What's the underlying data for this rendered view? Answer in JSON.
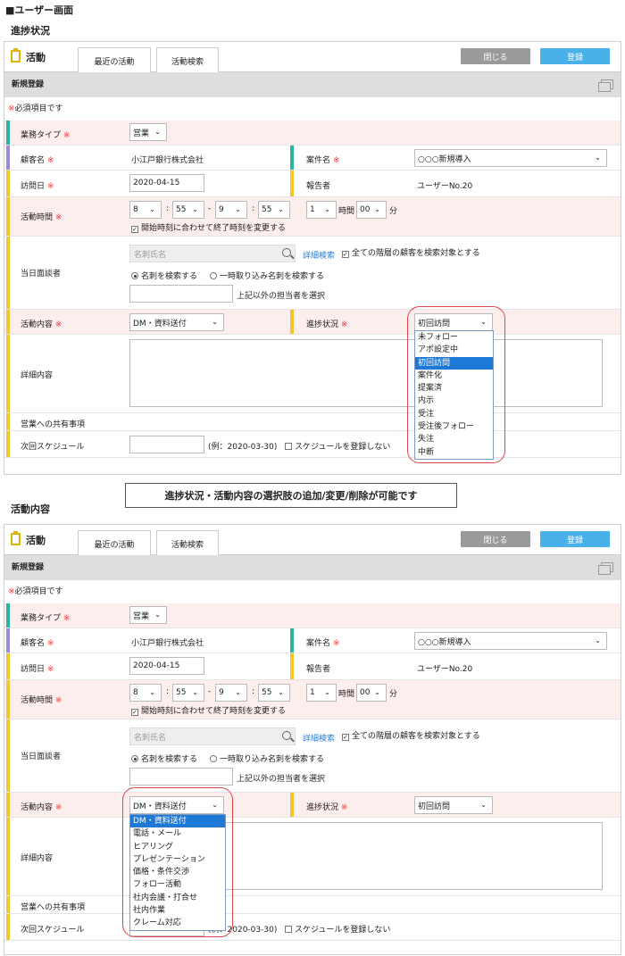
{
  "page_title": "■ユーザー画面",
  "section1_title": "進捗状況",
  "section2_title": "活動内容",
  "callout": "進捗状況・活動内容の選択肢の追加/変更/削除が可能です",
  "app": {
    "title": "活動",
    "tabs": [
      "最近の活動",
      "活動検索"
    ],
    "close_label": "閉じる",
    "register_label": "登録"
  },
  "header": "新規登録",
  "required_note": "必須項目です",
  "required_mark": "※",
  "form": {
    "business_type": {
      "label": "業務タイプ",
      "value": "営業"
    },
    "customer": {
      "label": "顧客名",
      "value": "小江戸銀行株式会社"
    },
    "case": {
      "label": "案件名",
      "value": "○○○新規導入"
    },
    "visit_date": {
      "label": "訪問日",
      "value": "2020-04-15"
    },
    "reporter": {
      "label": "報告者",
      "value": "ユーザーNo.20"
    },
    "activity_time": {
      "label": "活動時間",
      "start_hour": "8",
      "start_min": "55",
      "dash": "-",
      "end_hour": "9",
      "end_min": "55",
      "duration_hour": "1",
      "hour_unit": "時間",
      "duration_min": "00",
      "min_unit": "分",
      "auto_end_note": "開始時刻に合わせて終了時刻を変更する"
    },
    "attendees": {
      "label": "当日面談者",
      "search_placeholder": "名刺氏名",
      "detail_search": "詳細検索",
      "all_levels": "全ての階層の顧客を検索対象とする",
      "radio_card": "名刺を検索する",
      "radio_temp": "一時取り込み名刺を検索する",
      "other_staff": "上記以外の担当者を選択"
    },
    "activity_content": {
      "label": "活動内容",
      "value": "DM・資料送付"
    },
    "progress": {
      "label": "進捗状況",
      "value": "初回訪問"
    },
    "detail": {
      "label": "詳細内容"
    },
    "sales_share": {
      "label": "営業への共有事項"
    },
    "next_schedule": {
      "label": "次回スケジュール",
      "example": "(例：2020-03-30)",
      "no_register": "スケジュールを登録しない"
    }
  },
  "progress_options": [
    "未フォロー",
    "アポ設定中",
    "初回訪問",
    "案件化",
    "提案済",
    "内示",
    "受注",
    "受注後フォロー",
    "失注",
    "中断"
  ],
  "progress_selected_index": 2,
  "activity_options": [
    "DM・資料送付",
    "電話・メール",
    "ヒアリング",
    "プレゼンテーション",
    "価格・条件交渉",
    "フォロー活動",
    "社内会議・打合せ",
    "社内作業",
    "クレーム対応"
  ],
  "activity_selected_index": 0,
  "colors": {
    "teal": "#2bb5a0",
    "purple": "#9a8ad8",
    "yellow": "#f0c52d",
    "pink_row": "#fdeeee",
    "required": "#e33333",
    "register_btn": "#4ab0ea",
    "close_btn": "#9a9a9a",
    "highlight": "#1e78d6",
    "callout_oval": "#e0454a"
  }
}
